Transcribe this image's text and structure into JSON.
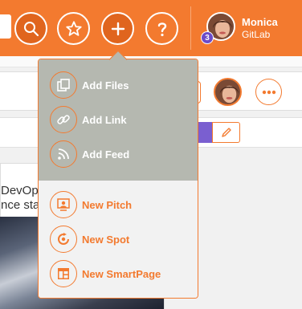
{
  "header": {
    "user": {
      "name": "Monica",
      "org": "GitLab",
      "notification_count": "3"
    },
    "buttons": [
      {
        "icon": "search-icon"
      },
      {
        "icon": "star-icon"
      },
      {
        "icon": "plus-icon"
      },
      {
        "icon": "help-icon"
      }
    ]
  },
  "background": {
    "left_text": [
      "DevOps",
      "nce stak"
    ]
  },
  "add_menu": {
    "content_items": [
      {
        "label": "Add Files",
        "icon": "files-icon"
      },
      {
        "label": "Add Link",
        "icon": "link-icon"
      },
      {
        "label": "Add Feed",
        "icon": "rss-feed-icon"
      }
    ],
    "create_items": [
      {
        "label": "New Pitch",
        "icon": "pitch-icon"
      },
      {
        "label": "New Spot",
        "icon": "spot-icon"
      },
      {
        "label": "New SmartPage",
        "icon": "smartpage-icon"
      }
    ]
  },
  "colors": {
    "brand_orange": "#f37a2f",
    "menu_top_bg": "#b5b8b0",
    "badge_purple": "#6b4bc8"
  }
}
